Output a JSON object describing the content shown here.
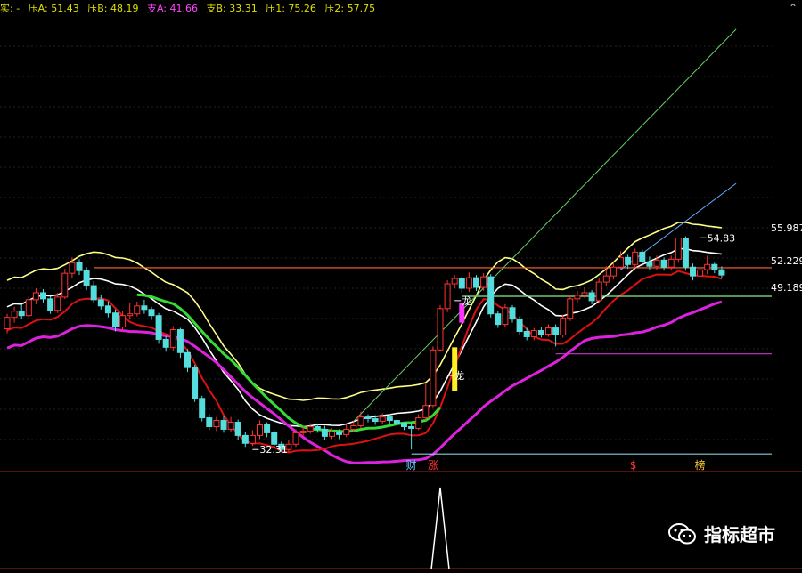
{
  "header": {
    "items": [
      {
        "label": "实: -",
        "color": "#e0e000"
      },
      {
        "label": "压A: 51.43",
        "color": "#e0e000"
      },
      {
        "label": "压B: 48.19",
        "color": "#e0e000"
      },
      {
        "label": "支A: 41.66",
        "color": "#ff44ff"
      },
      {
        "label": "支B: 33.31",
        "color": "#e0e000"
      },
      {
        "label": "压1: 75.26",
        "color": "#e0e000"
      },
      {
        "label": "压2: 57.75",
        "color": "#e0e000"
      }
    ],
    "collapse_glyph": "⌃"
  },
  "watermark": {
    "text": "指标超市",
    "icon": "wechat-icon"
  },
  "chart_data": {
    "type": "candlestick",
    "price_range": [
      28.5,
      80
    ],
    "grid": true,
    "candles": [
      [
        44.5,
        45.8,
        44.0,
        46.2
      ],
      [
        45.8,
        46.5,
        45.2,
        47.0
      ],
      [
        46.5,
        46.0,
        45.6,
        47.3
      ],
      [
        46.0,
        47.8,
        45.7,
        48.2
      ],
      [
        47.8,
        48.6,
        47.3,
        49.1
      ],
      [
        48.6,
        47.9,
        47.5,
        49.0
      ],
      [
        47.9,
        46.6,
        46.2,
        48.2
      ],
      [
        46.6,
        48.1,
        46.3,
        48.6
      ],
      [
        48.1,
        50.8,
        47.9,
        51.3
      ],
      [
        50.8,
        52.0,
        50.2,
        52.6
      ],
      [
        52.0,
        51.1,
        50.6,
        52.4
      ],
      [
        51.1,
        49.4,
        48.9,
        51.5
      ],
      [
        49.4,
        47.8,
        47.4,
        49.9
      ],
      [
        47.8,
        47.1,
        46.7,
        48.3
      ],
      [
        47.1,
        46.3,
        45.8,
        47.6
      ],
      [
        46.3,
        44.7,
        44.2,
        46.7
      ],
      [
        44.7,
        46.0,
        44.3,
        46.5
      ],
      [
        46.0,
        46.2,
        45.6,
        47.4
      ],
      [
        46.2,
        47.1,
        45.9,
        47.6
      ],
      [
        47.1,
        46.7,
        46.2,
        47.8
      ],
      [
        46.7,
        46.0,
        45.5,
        47.0
      ],
      [
        46.0,
        43.3,
        42.8,
        46.3
      ],
      [
        43.3,
        42.4,
        41.9,
        43.7
      ],
      [
        42.4,
        44.4,
        42.0,
        44.8
      ],
      [
        44.4,
        41.8,
        41.2,
        44.6
      ],
      [
        41.8,
        40.1,
        39.6,
        42.2
      ],
      [
        40.1,
        36.6,
        36.2,
        40.4
      ],
      [
        36.6,
        34.4,
        34.0,
        36.9
      ],
      [
        34.4,
        33.4,
        33.0,
        34.8
      ],
      [
        33.4,
        34.1,
        32.9,
        34.5
      ],
      [
        34.1,
        33.1,
        32.7,
        34.6
      ],
      [
        33.1,
        33.9,
        32.8,
        34.5
      ],
      [
        33.9,
        32.4,
        31.9,
        34.2
      ],
      [
        32.4,
        31.5,
        31.1,
        32.8
      ],
      [
        31.5,
        32.4,
        31.2,
        33.0
      ],
      [
        32.4,
        33.6,
        32.0,
        34.1
      ],
      [
        33.6,
        32.7,
        32.2,
        33.9
      ],
      [
        32.7,
        31.4,
        31.0,
        33.0
      ],
      [
        31.4,
        30.8,
        30.5,
        31.7
      ],
      [
        30.8,
        31.4,
        30.5,
        31.9
      ],
      [
        31.4,
        32.7,
        31.1,
        33.1
      ],
      [
        32.7,
        32.9,
        32.3,
        33.4
      ],
      [
        32.9,
        33.4,
        32.6,
        33.8
      ],
      [
        33.4,
        33.1,
        32.7,
        33.7
      ],
      [
        33.1,
        32.3,
        31.9,
        33.5
      ],
      [
        32.3,
        32.8,
        32.0,
        33.2
      ],
      [
        32.8,
        32.5,
        32.0,
        33.1
      ],
      [
        32.5,
        33.1,
        32.2,
        33.6
      ],
      [
        33.1,
        33.5,
        32.8,
        34.0
      ],
      [
        33.5,
        34.5,
        33.2,
        35.1
      ],
      [
        34.5,
        34.3,
        33.9,
        34.8
      ],
      [
        34.3,
        34.0,
        33.6,
        34.7
      ],
      [
        34.0,
        34.5,
        33.7,
        34.9
      ],
      [
        34.5,
        34.1,
        33.7,
        34.8
      ],
      [
        34.1,
        33.8,
        33.4,
        34.3
      ],
      [
        33.8,
        33.4,
        33.0,
        33.9
      ],
      [
        33.4,
        33.2,
        30.8,
        33.8
      ],
      [
        33.2,
        34.4,
        33.0,
        34.8
      ],
      [
        34.4,
        35.8,
        34.1,
        38.4
      ],
      [
        35.8,
        42.1,
        35.6,
        42.5
      ],
      [
        42.1,
        46.8,
        41.9,
        47.2
      ],
      [
        46.8,
        49.6,
        46.4,
        50.0
      ],
      [
        49.6,
        50.2,
        49.1,
        50.6
      ],
      [
        50.2,
        49.1,
        48.6,
        50.4
      ],
      [
        49.1,
        50.3,
        48.7,
        50.9
      ],
      [
        50.3,
        49.2,
        48.8,
        50.6
      ],
      [
        49.2,
        50.4,
        48.8,
        50.8
      ],
      [
        50.4,
        46.2,
        45.8,
        50.7
      ],
      [
        46.2,
        45.0,
        44.6,
        46.5
      ],
      [
        45.0,
        46.9,
        44.7,
        47.3
      ],
      [
        46.9,
        45.6,
        45.2,
        47.2
      ],
      [
        45.6,
        44.2,
        43.8,
        45.9
      ],
      [
        44.2,
        43.6,
        43.2,
        44.6
      ],
      [
        43.6,
        44.3,
        43.2,
        44.6
      ],
      [
        44.3,
        43.9,
        43.5,
        44.7
      ],
      [
        43.9,
        44.6,
        43.6,
        45.0
      ],
      [
        44.6,
        43.8,
        42.5,
        45.0
      ],
      [
        43.8,
        45.7,
        43.5,
        46.1
      ],
      [
        45.7,
        47.9,
        45.4,
        48.3
      ],
      [
        47.9,
        48.3,
        47.4,
        48.8
      ],
      [
        48.3,
        48.6,
        48.0,
        49.2
      ],
      [
        48.6,
        47.7,
        47.3,
        48.9
      ],
      [
        47.7,
        49.8,
        47.4,
        50.2
      ],
      [
        49.8,
        50.5,
        49.4,
        51.6
      ],
      [
        50.5,
        51.5,
        50.1,
        52.0
      ],
      [
        51.5,
        52.6,
        51.2,
        53.3
      ],
      [
        52.6,
        51.8,
        51.3,
        52.9
      ],
      [
        51.8,
        53.2,
        51.4,
        53.6
      ],
      [
        53.2,
        52.1,
        51.6,
        53.5
      ],
      [
        52.1,
        51.6,
        51.2,
        52.7
      ],
      [
        51.6,
        52.3,
        51.2,
        52.8
      ],
      [
        52.3,
        51.5,
        51.1,
        52.6
      ],
      [
        51.5,
        52.4,
        51.1,
        52.8
      ],
      [
        52.4,
        54.8,
        52.0,
        54.8
      ],
      [
        54.8,
        51.5,
        51.1,
        55.0
      ],
      [
        51.5,
        50.5,
        50.0,
        51.9
      ],
      [
        50.5,
        51.2,
        50.1,
        51.6
      ],
      [
        51.2,
        51.8,
        50.7,
        52.8
      ],
      [
        51.8,
        51.2,
        50.8,
        52.0
      ],
      [
        51.2,
        50.6,
        50.2,
        51.6
      ]
    ],
    "overlay_lines": {
      "upper_band": {
        "color": "#ffff88"
      },
      "middle_band": {
        "color": "#ffffff"
      },
      "ma_short": {
        "color": "#dd1111"
      },
      "ma_long": {
        "color": "#dd22dd"
      },
      "support_green": {
        "color": "#33dd33"
      }
    },
    "h_lines": [
      {
        "price": 51.43,
        "color": "#ff6633",
        "from": 12,
        "to": 100
      },
      {
        "price": 48.19,
        "color": "#88ee88",
        "from": 63,
        "to": 100
      },
      {
        "price": 41.66,
        "color": "#cc33cc",
        "from": 76,
        "to": 100
      },
      {
        "price": 30.3,
        "color": "#88ccdd",
        "from": 56,
        "to": 100
      }
    ],
    "diag_lines": [
      {
        "from_index": 48,
        "from_price": 34.0,
        "to_index": 101,
        "to_price": 78.5,
        "color": "#66cc66"
      },
      {
        "from_index": 85,
        "from_price": 51.2,
        "to_index": 101,
        "to_price": 61.0,
        "color": "#66aaff"
      }
    ],
    "right_labels": [
      "55.987",
      "52.229",
      "49.189"
    ],
    "right_label_prices": [
      55.987,
      52.229,
      49.189
    ],
    "annotations": [
      {
        "text": "54.83",
        "index": 96,
        "price": 54.83
      },
      {
        "text": "32.31",
        "index": 34,
        "price": 30.8
      },
      {
        "text": "龙",
        "index": 62,
        "price": 47.7
      },
      {
        "text": "龙",
        "index": 61,
        "price": 39.2
      }
    ],
    "event_markers": [
      {
        "text": "财",
        "index": 56,
        "color": "#66ccff"
      },
      {
        "text": "涨",
        "index": 59,
        "color": "#ff3333"
      },
      {
        "text": "$",
        "index": 87,
        "color": "#ff3333"
      },
      {
        "text": "榜",
        "index": 96,
        "color": "#ffcc33"
      }
    ],
    "lower_panel": {
      "spike_index": 60,
      "color": "#ffffff"
    }
  }
}
